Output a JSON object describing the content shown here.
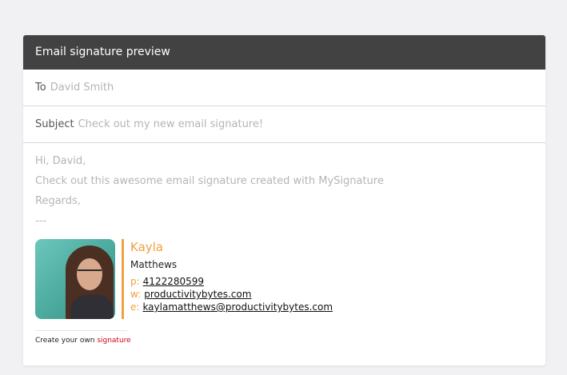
{
  "header": {
    "title": "Email signature preview"
  },
  "to": {
    "label": "To",
    "value": "David Smith"
  },
  "subject": {
    "label": "Subject",
    "value": "Check out my new email signature!"
  },
  "body": {
    "greeting": "Hi, David,",
    "message": "Check out this awesome email signature created with MySignature",
    "closing": "Regards,",
    "separator": "---"
  },
  "signature": {
    "first_name": "Kayla",
    "last_name": "Matthews",
    "phone_label": "p:",
    "phone": "4122280599",
    "web_label": "w:",
    "website": "productivitybytes.com",
    "email_label": "e:",
    "email": "kaylamatthews@productivitybytes.com",
    "accent_color": "#f0a040"
  },
  "footer": {
    "text": "Create your own",
    "link": "signature"
  }
}
